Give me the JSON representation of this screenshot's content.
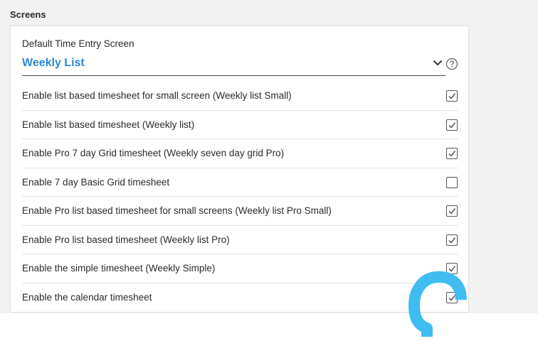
{
  "section": {
    "title": "Screens"
  },
  "default_screen": {
    "label": "Default Time Entry Screen",
    "value": "Weekly List"
  },
  "options": [
    {
      "label": "Enable list based timesheet for small screen (Weekly list Small)",
      "checked": true
    },
    {
      "label": "Enable list based timesheet (Weekly list)",
      "checked": true
    },
    {
      "label": "Enable Pro 7 day Grid timesheet (Weekly seven day grid Pro)",
      "checked": true
    },
    {
      "label": "Enable 7 day Basic Grid timesheet",
      "checked": false
    },
    {
      "label": "Enable Pro list based timesheet for small screens (Weekly list Pro Small)",
      "checked": true
    },
    {
      "label": "Enable Pro list based timesheet (Weekly list Pro)",
      "checked": true
    },
    {
      "label": "Enable the simple timesheet (Weekly Simple)",
      "checked": true
    },
    {
      "label": "Enable the calendar timesheet",
      "checked": true
    }
  ],
  "colors": {
    "accent": "#2f86d6",
    "annotation": "#3fbdf0"
  },
  "icons": {
    "dropdown": "chevron-down-icon",
    "help": "help-circle-icon",
    "check": "checkmark-icon"
  }
}
